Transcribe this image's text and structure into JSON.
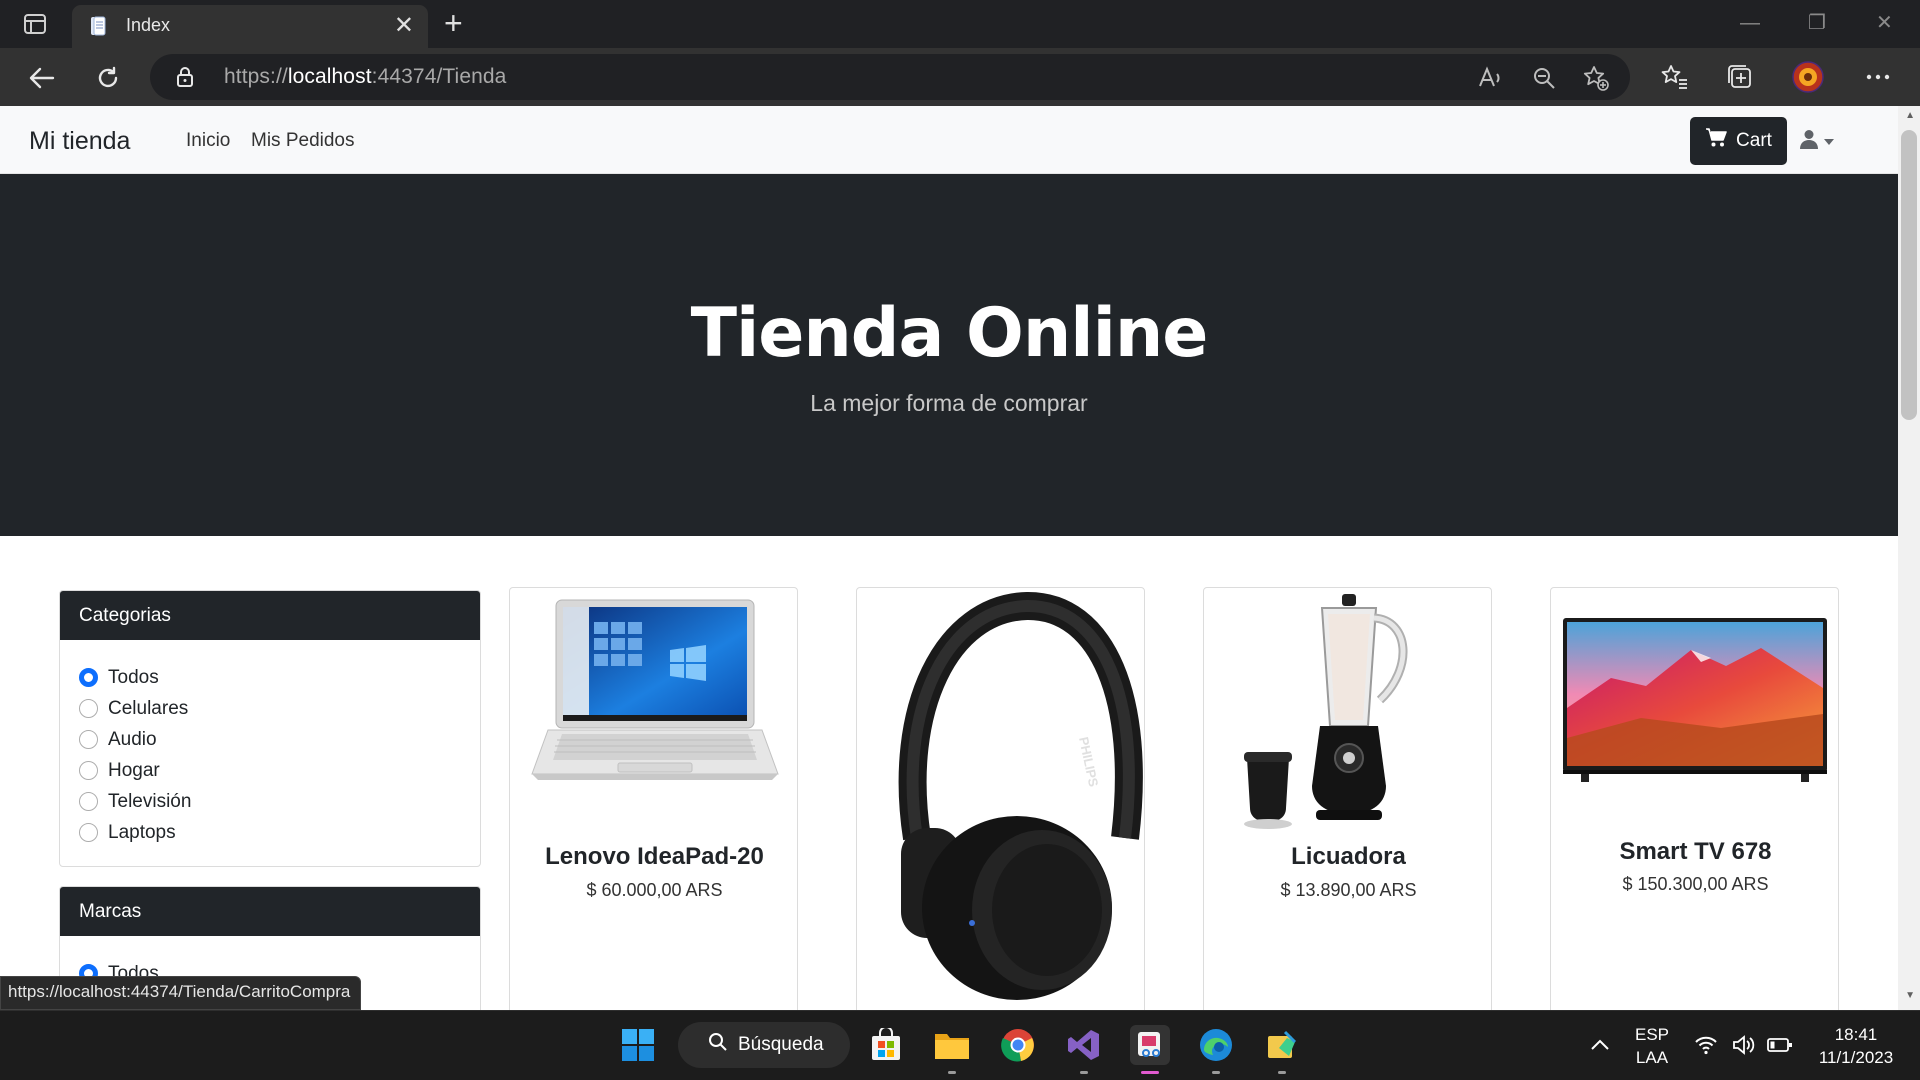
{
  "browser": {
    "tab_title": "Index",
    "url_prefix": "https://",
    "url_host": "localhost",
    "url_rest": ":44374/Tienda",
    "status_url": "https://localhost:44374/Tienda/CarritoCompra"
  },
  "site": {
    "brand": "Mi tienda",
    "nav": [
      "Inicio",
      "Mis Pedidos"
    ],
    "cart_label": "Cart"
  },
  "hero": {
    "title": "Tienda Online",
    "subtitle": "La mejor forma de comprar"
  },
  "filters": {
    "categories": {
      "title": "Categorias",
      "options": [
        "Todos",
        "Celulares",
        "Audio",
        "Hogar",
        "Televisión",
        "Laptops"
      ],
      "selected": "Todos"
    },
    "brands": {
      "title": "Marcas",
      "options": [
        "Todos"
      ],
      "selected": "Todos"
    }
  },
  "products": [
    {
      "name": "Lenovo IdeaPad-20",
      "price": "$ 60.000,00 ARS",
      "icon": "laptop-image"
    },
    {
      "name": "",
      "price": "",
      "icon": "headphones-image"
    },
    {
      "name": "Licuadora",
      "price": "$ 13.890,00 ARS",
      "icon": "blender-image"
    },
    {
      "name": "Smart TV 678",
      "price": "$ 150.300,00 ARS",
      "icon": "tv-image"
    }
  ],
  "headphone_brand": "PHILIPS",
  "taskbar": {
    "search_label": "Búsqueda",
    "lang_top": "ESP",
    "lang_bottom": "LAA",
    "time": "18:41",
    "date": "11/1/2023"
  },
  "colors": {
    "dark": "#212529",
    "accent": "#0d6efd"
  }
}
